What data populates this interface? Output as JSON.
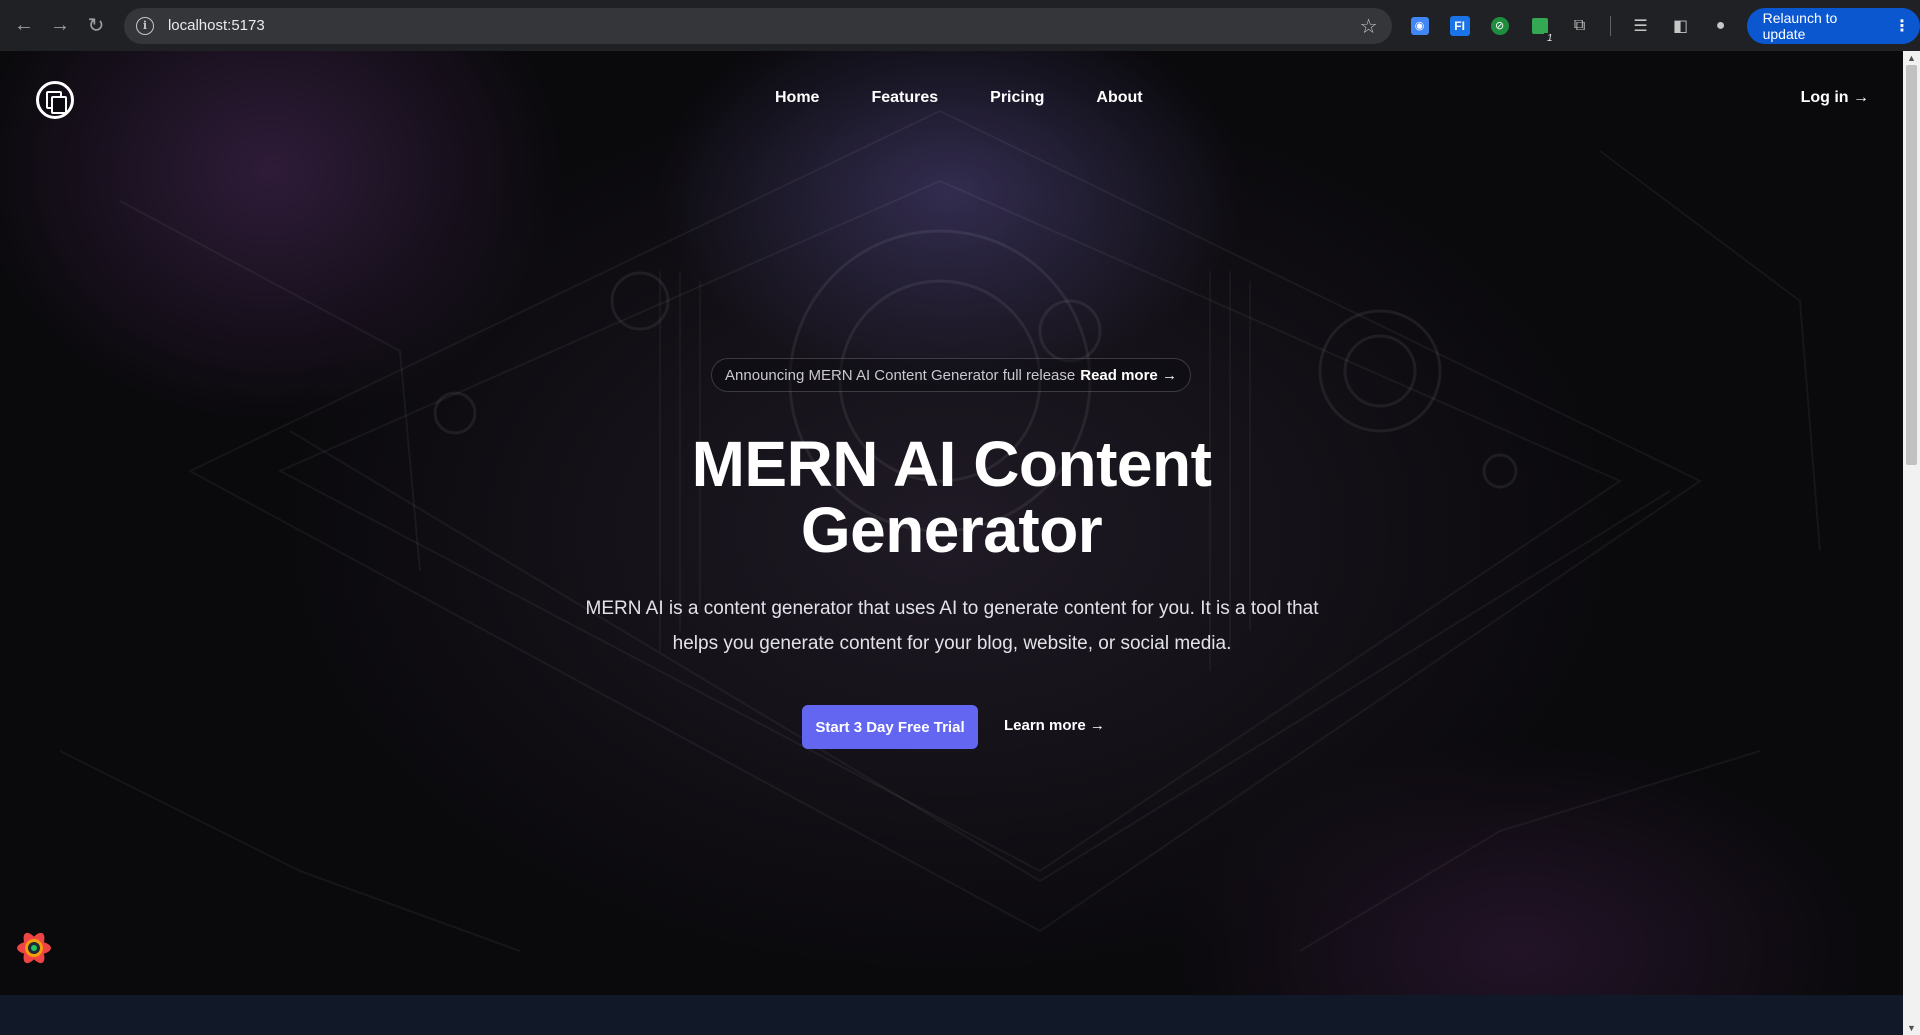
{
  "browser": {
    "url": "localhost:5173",
    "relaunch_label": "Relaunch to update",
    "extension_badge": "1",
    "fi_ext_label": "FI"
  },
  "nav": {
    "items": [
      {
        "label": "Home"
      },
      {
        "label": "Features"
      },
      {
        "label": "Pricing"
      },
      {
        "label": "About"
      }
    ],
    "login_label": "Log in →"
  },
  "hero": {
    "announcement_text": "Announcing MERN AI Content Generator full release",
    "announcement_link": "Read more →",
    "title_line1": "MERN AI Content",
    "title_line2": "Generator",
    "description": "MERN AI is a content generator that uses AI to generate content for you. It is a tool that helps you generate content for your blog, website, or social media.",
    "cta_label": "Start 3 Day Free Trial",
    "learn_more_label": "Learn more →"
  },
  "colors": {
    "accent": "#6366f1",
    "relaunch": "#0b57d0",
    "footer": "#111827"
  }
}
